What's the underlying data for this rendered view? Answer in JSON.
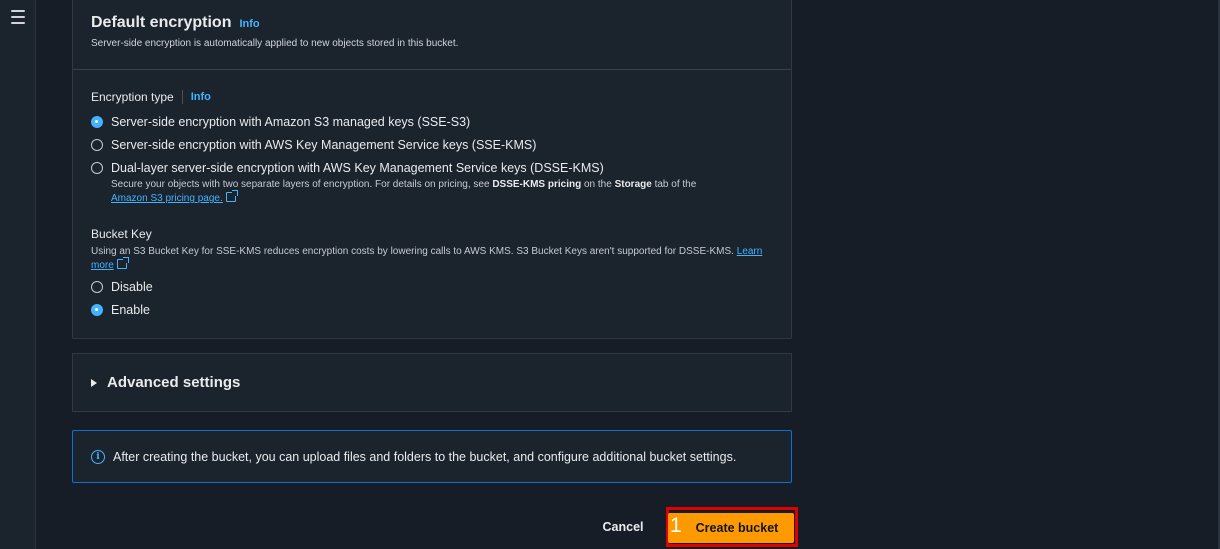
{
  "default_encryption": {
    "title": "Default encryption",
    "info": "Info",
    "description": "Server-side encryption is automatically applied to new objects stored in this bucket."
  },
  "encryption_type": {
    "label": "Encryption type",
    "info": "Info",
    "options": [
      {
        "label": "Server-side encryption with Amazon S3 managed keys (SSE-S3)",
        "checked": true
      },
      {
        "label": "Server-side encryption with AWS Key Management Service keys (SSE-KMS)",
        "checked": false
      },
      {
        "label": "Dual-layer server-side encryption with AWS Key Management Service keys (DSSE-KMS)",
        "checked": false
      }
    ],
    "dsse_desc_prefix": "Secure your objects with two separate layers of encryption. For details on pricing, see ",
    "dsse_desc_bold1": "DSSE-KMS pricing",
    "dsse_desc_mid": " on the ",
    "dsse_desc_bold2": "Storage",
    "dsse_desc_suffix": " tab of the",
    "dsse_link": "Amazon S3 pricing page."
  },
  "bucket_key": {
    "label": "Bucket Key",
    "description": "Using an S3 Bucket Key for SSE-KMS reduces encryption costs by lowering calls to AWS KMS. S3 Bucket Keys aren't supported for DSSE-KMS.",
    "learn_more": "Learn more",
    "options": [
      {
        "label": "Disable",
        "checked": false
      },
      {
        "label": "Enable",
        "checked": true
      }
    ]
  },
  "advanced_settings": {
    "title": "Advanced settings"
  },
  "alert": {
    "text": "After creating the bucket, you can upload files and folders to the bucket, and configure additional bucket settings."
  },
  "footer": {
    "cancel": "Cancel",
    "create": "Create bucket",
    "step_marker": "1"
  },
  "colors": {
    "accent": "#42b4ff",
    "primary_button": "#ff9900",
    "highlight": "#e00000",
    "background": "#161d26"
  },
  "icons": [
    "menu-icon",
    "info-icon",
    "external-link-icon",
    "caret-right-icon"
  ]
}
